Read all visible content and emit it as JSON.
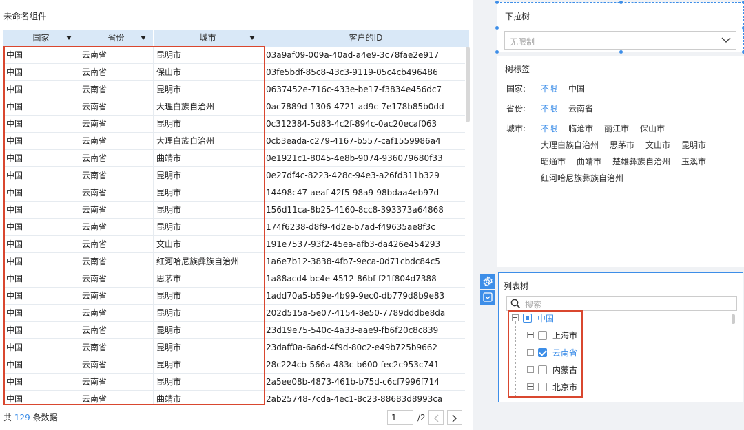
{
  "component_title": "未命名组件",
  "table": {
    "headers": [
      "国家",
      "省份",
      "城市",
      "客户的ID"
    ],
    "rows": [
      [
        "中国",
        "云南省",
        "昆明市",
        "03a9af09-009a-40ad-a4e9-3c78fae2e917"
      ],
      [
        "中国",
        "云南省",
        "保山市",
        "03fe5bdf-85c8-43c3-9119-05c4cb496486"
      ],
      [
        "中国",
        "云南省",
        "昆明市",
        "0637452e-716c-433e-be17-f3834e456dc7"
      ],
      [
        "中国",
        "云南省",
        "大理白族自治州",
        "0ac7889d-1306-4721-ad9c-7e178b85b0dd"
      ],
      [
        "中国",
        "云南省",
        "昆明市",
        "0c312384-5d83-4c2f-894c-0ac20ecaf063"
      ],
      [
        "中国",
        "云南省",
        "大理白族自治州",
        "0cb3eada-c279-4167-b557-caf1559986a4"
      ],
      [
        "中国",
        "云南省",
        "曲靖市",
        "0e1921c1-8045-4e8b-9074-936079680f33"
      ],
      [
        "中国",
        "云南省",
        "昆明市",
        "0e27df4c-8223-428c-94e3-a26fd311b329"
      ],
      [
        "中国",
        "云南省",
        "昆明市",
        "14498c47-aeaf-42f5-98a9-98bdaa4eb97d"
      ],
      [
        "中国",
        "云南省",
        "昆明市",
        "156d11ca-8b25-4160-8cc8-393373a64868"
      ],
      [
        "中国",
        "云南省",
        "昆明市",
        "174f6238-d8f9-4d2e-b7ad-f49635ae8f3c"
      ],
      [
        "中国",
        "云南省",
        "文山市",
        "191e7537-93f2-45ea-afb3-da426e454293"
      ],
      [
        "中国",
        "云南省",
        "红河哈尼族彝族自治州",
        "1a6e7b12-3838-4fb7-9eca-0d71cbdc84c5"
      ],
      [
        "中国",
        "云南省",
        "思茅市",
        "1a88acd4-bc4e-4512-86bf-f21f804d7388"
      ],
      [
        "中国",
        "云南省",
        "昆明市",
        "1add70a5-b59e-4b99-9ec0-db779d8b9e83"
      ],
      [
        "中国",
        "云南省",
        "昆明市",
        "202d515a-5e07-4154-8e50-7789dddbe8da"
      ],
      [
        "中国",
        "云南省",
        "昆明市",
        "23d19e75-540c-4a33-aae9-fb6f20c8c839"
      ],
      [
        "中国",
        "云南省",
        "昆明市",
        "23daff0a-6a6d-4f9d-80c2-e49b725b9662"
      ],
      [
        "中国",
        "云南省",
        "昆明市",
        "28c224cb-566a-483c-b600-fec2c953c741"
      ],
      [
        "中国",
        "云南省",
        "昆明市",
        "2a5ee08b-4873-461b-b75d-c6cf7996f714"
      ],
      [
        "中国",
        "云南省",
        "曲靖市",
        "2ab25748-7cda-4ec1-8c23-88683d8993ca"
      ]
    ]
  },
  "footer": {
    "prefix": "共",
    "count": "129",
    "suffix": "条数据"
  },
  "pager": {
    "current": "1",
    "total": "/2"
  },
  "dropdown_tree": {
    "label": "下拉树",
    "placeholder": "无限制"
  },
  "tag_tree": {
    "label": "树标签",
    "groups": [
      {
        "label": "国家:",
        "tags": [
          "不限",
          "中国"
        ]
      },
      {
        "label": "省份:",
        "tags": [
          "不限",
          "云南省"
        ]
      },
      {
        "label": "城市:",
        "tags": [
          "不限",
          "临沧市",
          "丽江市",
          "保山市",
          "大理白族自治州",
          "思茅市",
          "文山市",
          "昆明市",
          "昭通市",
          "曲靖市",
          "楚雄彝族自治州",
          "玉溪市",
          "红河哈尼族彝族自治州"
        ]
      }
    ]
  },
  "list_tree": {
    "label": "列表树",
    "search_placeholder": "搜索",
    "nodes": [
      {
        "label": "中国",
        "state": "partial",
        "expanded": true
      },
      {
        "label": "上海市",
        "state": "unchecked"
      },
      {
        "label": "云南省",
        "state": "checked"
      },
      {
        "label": "内蒙古",
        "state": "unchecked"
      },
      {
        "label": "北京市",
        "state": "unchecked"
      }
    ]
  },
  "colors": {
    "accent": "#3d8ee8",
    "highlight_box": "#d9472f",
    "header_bg": "#d9e8f7"
  }
}
